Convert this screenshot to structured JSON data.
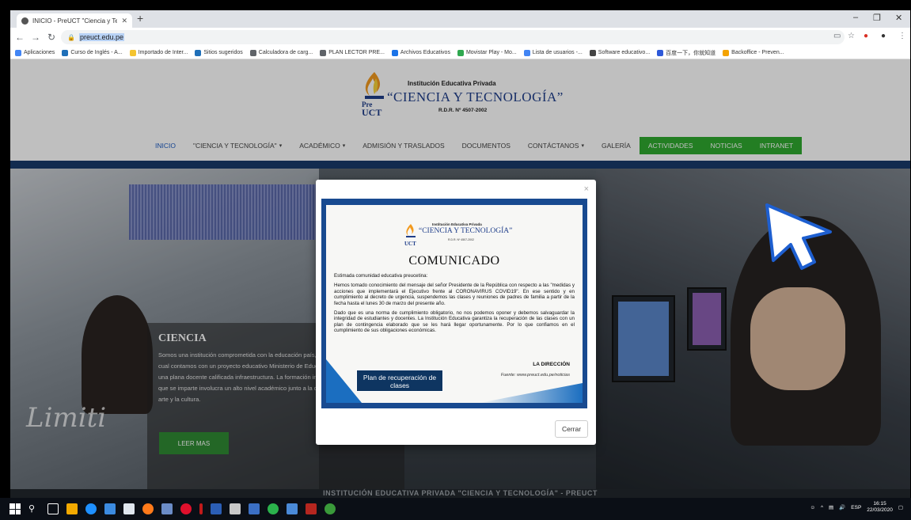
{
  "browser": {
    "tab_title": "INICIO - PreUCT \"Ciencia y Tecn…",
    "tab_close": "✕",
    "new_tab": "+",
    "url": "preuct.edu.pe",
    "window_controls": {
      "minimize": "–",
      "restore": "❐",
      "close": "✕"
    }
  },
  "bookmarks": [
    {
      "label": "Aplicaciones",
      "color": "#4285f4"
    },
    {
      "label": "Curso de Inglés - A...",
      "color": "#1f6fb8"
    },
    {
      "label": "Importado de Inter...",
      "color": "#f4c430"
    },
    {
      "label": "Sitios sugeridos",
      "color": "#1f6fb8"
    },
    {
      "label": "Calculadora de carg...",
      "color": "#5f6368"
    },
    {
      "label": "PLAN LECTOR PRE...",
      "color": "#5f6368"
    },
    {
      "label": "Archivos Educativos",
      "color": "#1a73e8"
    },
    {
      "label": "Movistar Play - Mo...",
      "color": "#2fa84f"
    },
    {
      "label": "Lista de usuarios -...",
      "color": "#4285f4"
    },
    {
      "label": "Software educativo...",
      "color": "#444"
    },
    {
      "label": "百度一下，你就知道",
      "color": "#2e59d9"
    },
    {
      "label": "Backoffice - Preven...",
      "color": "#f4a300"
    }
  ],
  "site": {
    "brand_top": "Institución Educativa Privada",
    "brand_main": "“CIENCIA Y TECNOLOGÍA”",
    "brand_sub": "R.D.R. Nº 4507-2002",
    "nav": [
      {
        "label": "INICIO",
        "caret": false,
        "style": "active"
      },
      {
        "label": "\"CIENCIA Y TECNOLOGÍA\"",
        "caret": true,
        "style": "normal"
      },
      {
        "label": "ACADÉMICO",
        "caret": true,
        "style": "normal"
      },
      {
        "label": "ADMISIÓN Y TRASLADOS",
        "caret": false,
        "style": "normal"
      },
      {
        "label": "DOCUMENTOS",
        "caret": false,
        "style": "normal"
      },
      {
        "label": "CONTÁCTANOS",
        "caret": true,
        "style": "normal"
      },
      {
        "label": "GALERÍA",
        "caret": false,
        "style": "normal"
      },
      {
        "label": "ACTIVIDADES",
        "caret": false,
        "style": "green"
      },
      {
        "label": "NOTICIAS",
        "caret": false,
        "style": "green"
      },
      {
        "label": "INTRANET",
        "caret": false,
        "style": "green"
      }
    ],
    "hero": {
      "title": "CIENCIA",
      "body": "Somos una institución comprometida con la educación país, para lo cual contamos con un proyecto educativo Ministerio de Educación, una plana docente calificada infraestructura. La formación integral que se imparte involucra un alto nivel académico junto a la disciplina, arte y la cultura.",
      "button": "LEER MAS",
      "signature": "Limiti"
    },
    "bottom_strip": "INSTITUCIÓN EDUCATIVA PRIVADA \"CIENCIA Y TECNOLOGÍA\" - PREUCT"
  },
  "modal": {
    "close_x": "×",
    "flyer": {
      "brand_top": "Institución Educativa Privada",
      "brand_main": "“CIENCIA Y TECNOLOGÍA”",
      "brand_sub": "R.D.R. Nº 4507-2002",
      "title": "COMUNICADO",
      "greeting": "Estimada comunidad educativa preucetina:",
      "paragraph1": "Hemos tomado conocimiento del mensaje del señor Presidente de la República con respecto a las \"medidas y acciones que implementará el Ejecutivo frente al CORONAVIRUS COVID19\". En ese sentido y en cumplimiento al decreto de urgencia, suspendemos las clases y reuniones de padres de familia a partir de la fecha hasta el lunes 30 de marzo del presente año.",
      "paragraph2": "Dado que es una norma de cumplimiento obligatorio, no nos podemos oponer y debemos salvaguardar la integridad de estudiantes y docentes. La Institución Educativa garantiza la recuperación de las clases con un plan de contingencia elaborado que se les hará llegar oportunamente. Por lo que confiamos en el cumplimiento de sus obligaciones económicas.",
      "signature": "LA DIRECCIÓN",
      "source": "Fuente: www.preuct.edu.pe/noticias",
      "badge": "Plan de recuperación de clases"
    },
    "close_button": "Cerrar"
  },
  "taskbar": {
    "language": "ESP",
    "time": "16:15",
    "date": "22/03/2020"
  }
}
